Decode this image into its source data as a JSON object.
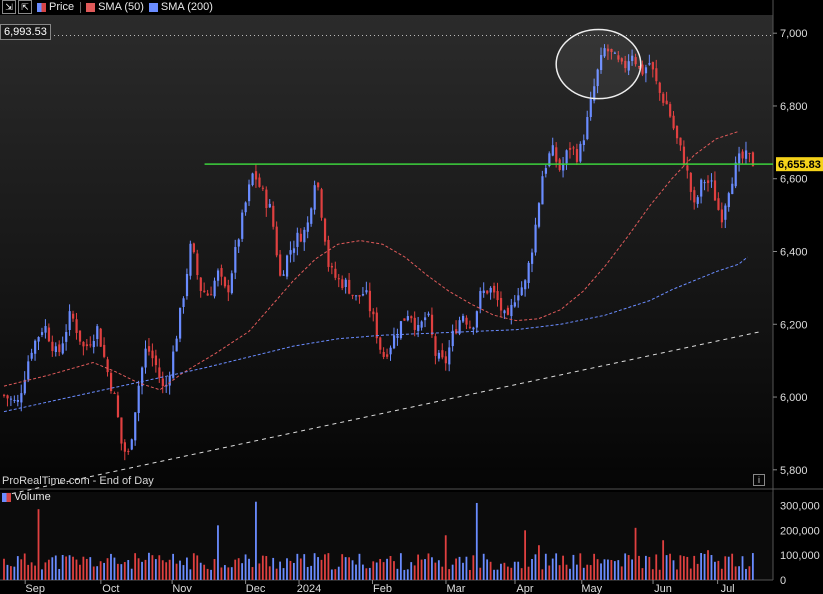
{
  "toolbar": {
    "price_label": "Price",
    "sma50_label": "SMA (50)",
    "sma200_label": "SMA (200)",
    "colors": {
      "price": "#d64545",
      "sma50": "#e05a5a",
      "sma200": "#6a8cff"
    }
  },
  "watermark": "ProRealTime.com - End of Day",
  "volume_label": "Volume",
  "dotted_price_label": "6,993.53",
  "last_price_label": "6,655.83",
  "info_icon": "i",
  "chart_data": {
    "type": "candlestick",
    "ylim": [
      5750,
      7050
    ],
    "y_ticks": [
      "7,000",
      "6,800",
      "6,600",
      "6,400",
      "6,200",
      "6,000",
      "5,800"
    ],
    "y_tick_values": [
      7000,
      6800,
      6600,
      6400,
      6200,
      6000,
      5800
    ],
    "x_labels": [
      "Sep",
      "Oct",
      "Nov",
      "Dec",
      "2024",
      "Feb",
      "Mar",
      "Apr",
      "May",
      "Jun",
      "Jul"
    ],
    "x_label_days": [
      14,
      48,
      80,
      113,
      137,
      170,
      203,
      234,
      264,
      296,
      325
    ],
    "x_range_days": [
      0,
      340
    ],
    "dotted_level": 6993.53,
    "horizontal_line": 6640,
    "trendline": {
      "start_day": 0,
      "start": 5730,
      "end_day": 340,
      "end": 6180
    },
    "sma50": [
      [
        0,
        6030
      ],
      [
        20,
        6060
      ],
      [
        40,
        6095
      ],
      [
        50,
        6070
      ],
      [
        60,
        6040
      ],
      [
        70,
        6020
      ],
      [
        80,
        6065
      ],
      [
        95,
        6120
      ],
      [
        110,
        6180
      ],
      [
        120,
        6250
      ],
      [
        130,
        6320
      ],
      [
        140,
        6380
      ],
      [
        150,
        6420
      ],
      [
        160,
        6430
      ],
      [
        170,
        6420
      ],
      [
        180,
        6385
      ],
      [
        190,
        6335
      ],
      [
        200,
        6290
      ],
      [
        210,
        6255
      ],
      [
        220,
        6225
      ],
      [
        230,
        6210
      ],
      [
        240,
        6215
      ],
      [
        250,
        6240
      ],
      [
        260,
        6290
      ],
      [
        270,
        6360
      ],
      [
        280,
        6440
      ],
      [
        290,
        6525
      ],
      [
        300,
        6600
      ],
      [
        310,
        6665
      ],
      [
        320,
        6710
      ],
      [
        330,
        6730
      ]
    ],
    "sma200": [
      [
        0,
        5960
      ],
      [
        30,
        6000
      ],
      [
        60,
        6040
      ],
      [
        90,
        6080
      ],
      [
        110,
        6110
      ],
      [
        130,
        6140
      ],
      [
        150,
        6160
      ],
      [
        170,
        6170
      ],
      [
        190,
        6175
      ],
      [
        210,
        6180
      ],
      [
        230,
        6185
      ],
      [
        250,
        6200
      ],
      [
        270,
        6225
      ],
      [
        290,
        6265
      ],
      [
        300,
        6295
      ],
      [
        310,
        6320
      ],
      [
        320,
        6345
      ],
      [
        330,
        6365
      ],
      [
        334,
        6385
      ]
    ],
    "price_path": [
      [
        0,
        6005
      ],
      [
        6,
        5980
      ],
      [
        12,
        6130
      ],
      [
        18,
        6200
      ],
      [
        24,
        6110
      ],
      [
        30,
        6230
      ],
      [
        36,
        6130
      ],
      [
        42,
        6190
      ],
      [
        46,
        6080
      ],
      [
        50,
        5990
      ],
      [
        53,
        5860
      ],
      [
        56,
        5840
      ],
      [
        60,
        6020
      ],
      [
        64,
        6140
      ],
      [
        68,
        6090
      ],
      [
        72,
        6010
      ],
      [
        76,
        6120
      ],
      [
        80,
        6260
      ],
      [
        84,
        6420
      ],
      [
        88,
        6300
      ],
      [
        92,
        6280
      ],
      [
        96,
        6340
      ],
      [
        100,
        6280
      ],
      [
        104,
        6400
      ],
      [
        108,
        6520
      ],
      [
        112,
        6620
      ],
      [
        116,
        6560
      ],
      [
        120,
        6510
      ],
      [
        124,
        6330
      ],
      [
        128,
        6400
      ],
      [
        132,
        6440
      ],
      [
        136,
        6460
      ],
      [
        140,
        6620
      ],
      [
        144,
        6450
      ],
      [
        146,
        6350
      ],
      [
        150,
        6320
      ],
      [
        154,
        6310
      ],
      [
        158,
        6270
      ],
      [
        162,
        6290
      ],
      [
        166,
        6210
      ],
      [
        170,
        6110
      ],
      [
        174,
        6150
      ],
      [
        178,
        6200
      ],
      [
        182,
        6240
      ],
      [
        186,
        6180
      ],
      [
        190,
        6230
      ],
      [
        194,
        6110
      ],
      [
        198,
        6090
      ],
      [
        202,
        6180
      ],
      [
        206,
        6230
      ],
      [
        210,
        6190
      ],
      [
        214,
        6280
      ],
      [
        218,
        6300
      ],
      [
        222,
        6260
      ],
      [
        226,
        6200
      ],
      [
        230,
        6290
      ],
      [
        234,
        6310
      ],
      [
        238,
        6440
      ],
      [
        242,
        6620
      ],
      [
        246,
        6680
      ],
      [
        250,
        6620
      ],
      [
        254,
        6690
      ],
      [
        258,
        6660
      ],
      [
        262,
        6760
      ],
      [
        266,
        6880
      ],
      [
        270,
        6960
      ],
      [
        274,
        6930
      ],
      [
        278,
        6900
      ],
      [
        282,
        6950
      ],
      [
        286,
        6890
      ],
      [
        290,
        6920
      ],
      [
        294,
        6840
      ],
      [
        298,
        6800
      ],
      [
        302,
        6710
      ],
      [
        306,
        6640
      ],
      [
        310,
        6520
      ],
      [
        314,
        6600
      ],
      [
        318,
        6580
      ],
      [
        322,
        6490
      ],
      [
        326,
        6590
      ],
      [
        330,
        6650
      ],
      [
        334,
        6660
      ],
      [
        337,
        6640
      ]
    ],
    "volume": {
      "y_ticks": [
        "300,000",
        "200,000",
        "100,000",
        "0"
      ],
      "y_tick_values": [
        300000,
        200000,
        100000,
        0
      ],
      "max": 330000,
      "spikes": [
        [
          15,
          285000
        ],
        [
          96,
          220000
        ],
        [
          113,
          315000
        ],
        [
          199,
          180000
        ],
        [
          212,
          310000
        ],
        [
          234,
          200000
        ],
        [
          241,
          140000
        ],
        [
          284,
          210000
        ],
        [
          296,
          160000
        ],
        [
          316,
          120000
        ]
      ]
    },
    "highlight_ellipse": {
      "center_day": 267,
      "center": 6915,
      "half_width_days": 19,
      "half_height": 95
    },
    "legend": "top-left",
    "grid": false
  }
}
